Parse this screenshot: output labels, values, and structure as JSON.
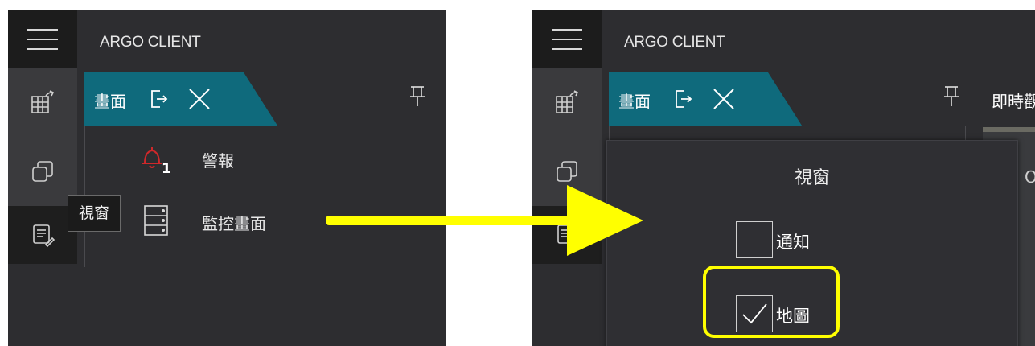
{
  "app": {
    "title": "ARGO CLIENT"
  },
  "tab": {
    "label": "畫面"
  },
  "left_panel": {
    "list": [
      {
        "label": "警報",
        "badge": "1"
      },
      {
        "label": "監控畫面"
      }
    ],
    "tooltip": "視窗"
  },
  "right_panel": {
    "live_label": "即時觀",
    "edge_char": "O",
    "popup": {
      "title": "視窗",
      "options": [
        {
          "label": "通知",
          "checked": false
        },
        {
          "label": "地圖",
          "checked": true
        }
      ]
    }
  },
  "colors": {
    "panel_bg": "#2d2d30",
    "rail_bg": "#3a3a3d",
    "tab_accent": "#0f6a7c",
    "alert_red": "#d0282a",
    "annotation_yellow": "#ffff00"
  },
  "icons": [
    "menu-icon",
    "export-icon",
    "close-icon",
    "pin-icon",
    "layout-icon",
    "window-icon",
    "notes-icon",
    "bell-icon",
    "server-icon",
    "checkmark-icon"
  ]
}
